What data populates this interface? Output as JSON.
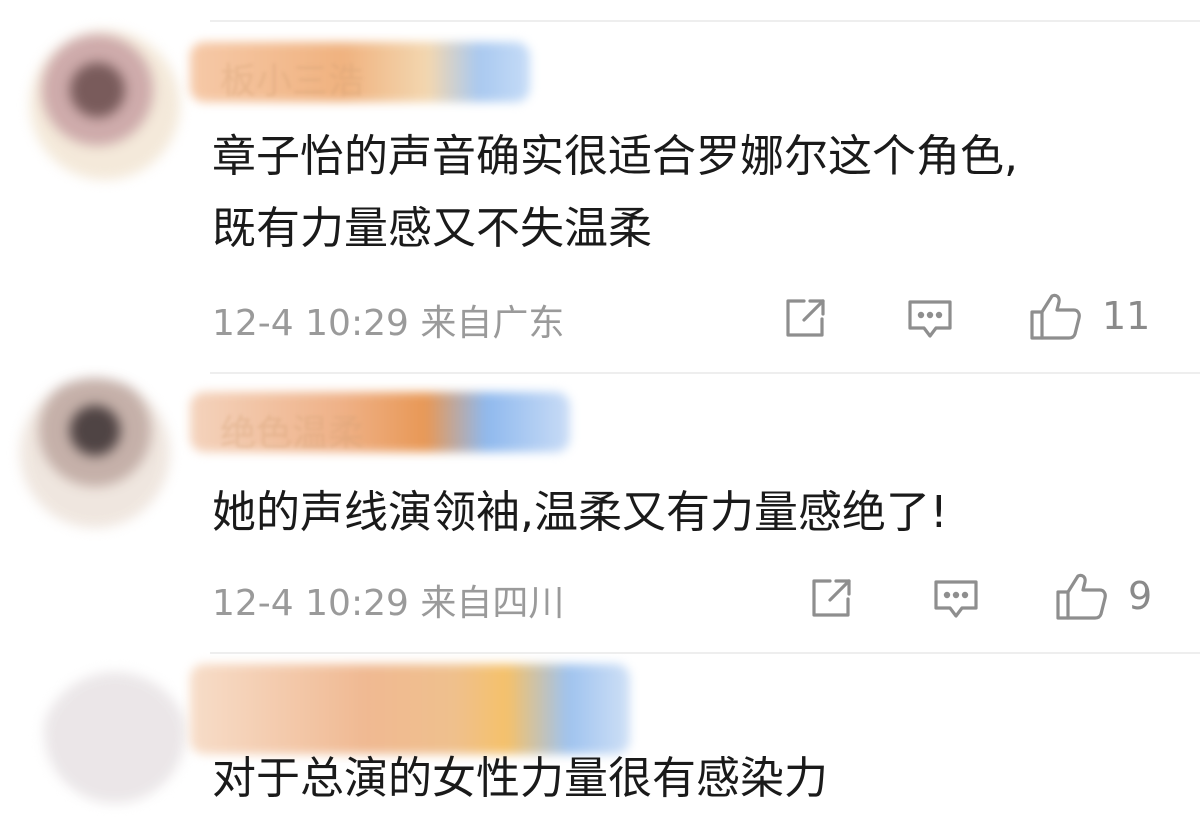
{
  "comments": [
    {
      "username": "板小三浩",
      "text_lines": [
        "章子怡的声音确实很适合罗娜尔这个角色,",
        "既有力量感又不失温柔"
      ],
      "time": "12-4 10:29",
      "location": "来自广东",
      "likes": "11"
    },
    {
      "username": "绝色温柔",
      "text_lines": [
        "她的声线演领袖,温柔又有力量感绝了!"
      ],
      "time": "12-4 10:29",
      "location": "来自四川",
      "likes": "9"
    },
    {
      "username": "",
      "text_lines": [
        "对于总演的女性力量很有感染力"
      ],
      "time": "",
      "location": "",
      "likes": ""
    }
  ],
  "icons": {
    "share": "share-icon",
    "reply": "comment-icon",
    "like": "thumbs-up-icon"
  },
  "colors": {
    "text": "#1a1a1a",
    "meta": "#9a9a9a",
    "divider": "#eeeeee"
  }
}
